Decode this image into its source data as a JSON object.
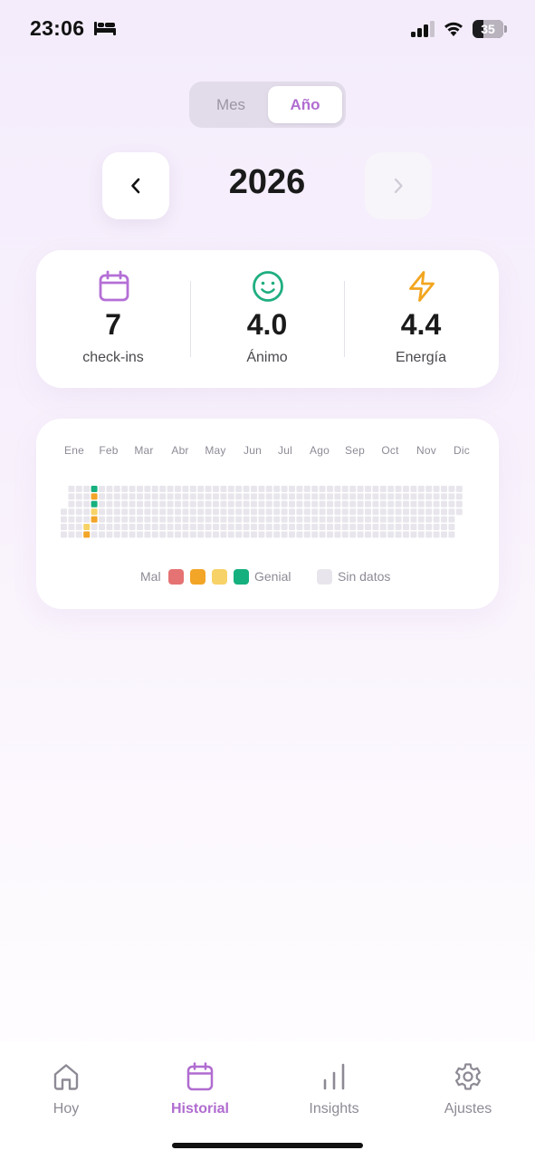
{
  "status_bar": {
    "time": "23:06",
    "battery": "35",
    "icons": [
      "bed-icon",
      "signal-icon",
      "wifi-icon",
      "battery-icon"
    ]
  },
  "view_toggle": {
    "options": [
      "Mes",
      "Año"
    ],
    "selected": "Año"
  },
  "year_nav": {
    "year": "2026",
    "prev_icon": "chevron-left-icon",
    "next_icon": "chevron-right-icon"
  },
  "stats": [
    {
      "icon": "calendar-icon",
      "value": "7",
      "label": "check-ins",
      "color": "#b46fd6"
    },
    {
      "icon": "smile-icon",
      "value": "4.0",
      "label": "Ánimo",
      "color": "#1fae80"
    },
    {
      "icon": "lightning-icon",
      "value": "4.4",
      "label": "Energía",
      "color": "#f2a51f"
    }
  ],
  "heatmap": {
    "months": [
      "Ene",
      "Feb",
      "Mar",
      "Abr",
      "May",
      "Jun",
      "Jul",
      "Ago",
      "Sep",
      "Oct",
      "Nov",
      "Dic"
    ],
    "legend": {
      "low": "Mal",
      "high": "Genial",
      "empty": "Sin datos"
    },
    "colors": {
      "mal": "#e57373",
      "bajo": "#f2a527",
      "medio": "#f7d266",
      "genial": "#16b07e",
      "empty": "#e8e6ec"
    },
    "filled_days": [
      {
        "week": 3,
        "day": 6,
        "level": "bajo"
      },
      {
        "week": 3,
        "day": 5,
        "level": "medio"
      },
      {
        "week": 4,
        "day": 0,
        "level": "genial"
      },
      {
        "week": 4,
        "day": 1,
        "level": "bajo"
      },
      {
        "week": 4,
        "day": 2,
        "level": "genial"
      },
      {
        "week": 4,
        "day": 3,
        "level": "medio"
      },
      {
        "week": 4,
        "day": 4,
        "level": "bajo"
      }
    ]
  },
  "tab_bar": {
    "active": "Historial",
    "tabs": [
      {
        "label": "Hoy",
        "icon": "home-icon"
      },
      {
        "label": "Historial",
        "icon": "calendar-icon"
      },
      {
        "label": "Insights",
        "icon": "bar-chart-icon"
      },
      {
        "label": "Ajustes",
        "icon": "gear-icon"
      }
    ]
  }
}
